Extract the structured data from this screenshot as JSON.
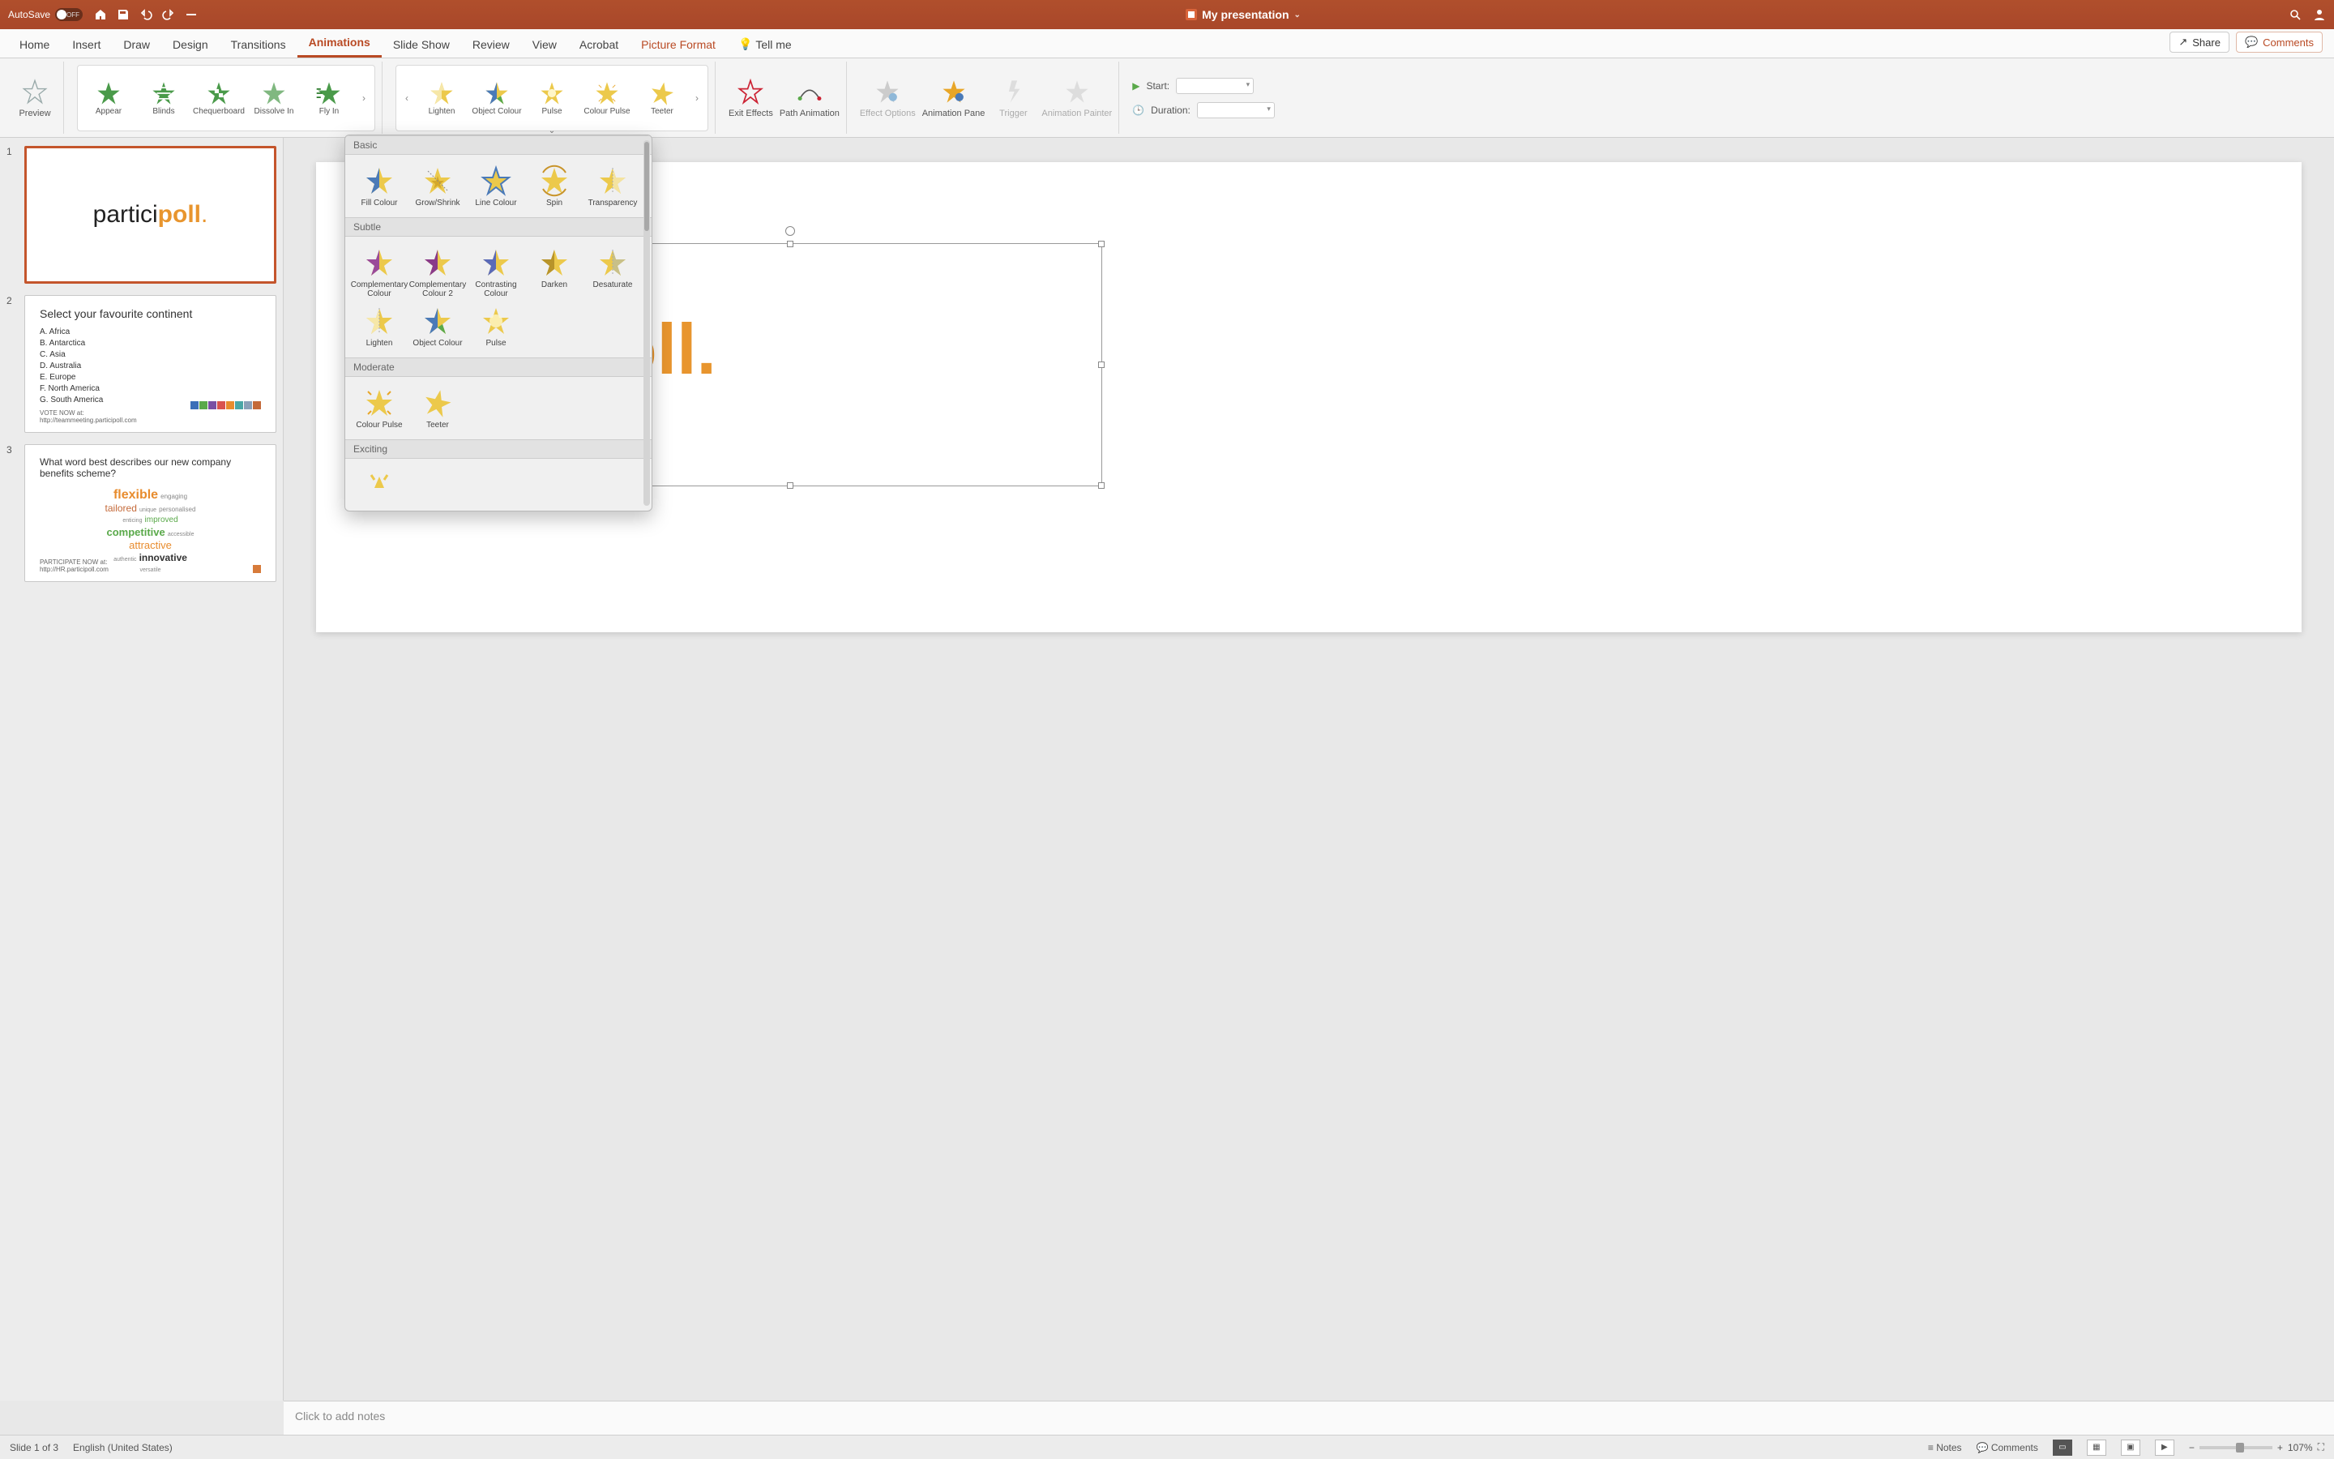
{
  "titlebar": {
    "autosave": "AutoSave",
    "toggle": "OFF",
    "title": "My presentation"
  },
  "tabs": {
    "items": [
      "Home",
      "Insert",
      "Draw",
      "Design",
      "Transitions",
      "Animations",
      "Slide Show",
      "Review",
      "View",
      "Acrobat",
      "Picture Format"
    ],
    "active_index": 5,
    "tellme": "Tell me",
    "share": "Share",
    "comments": "Comments"
  },
  "ribbon": {
    "preview": "Preview",
    "entrance": [
      {
        "label": "Appear"
      },
      {
        "label": "Blinds"
      },
      {
        "label": "Chequerboard"
      },
      {
        "label": "Dissolve In"
      },
      {
        "label": "Fly In"
      }
    ],
    "emphasis": [
      {
        "label": "Lighten"
      },
      {
        "label": "Object Colour"
      },
      {
        "label": "Pulse"
      },
      {
        "label": "Colour Pulse"
      },
      {
        "label": "Teeter"
      }
    ],
    "exit": "Exit Effects",
    "path": "Path Animation",
    "effect_options": "Effect Options",
    "animation_pane": "Animation Pane",
    "trigger": "Trigger",
    "animation_painter": "Animation Painter",
    "start": "Start:",
    "duration": "Duration:"
  },
  "dropdown": {
    "sections": [
      {
        "title": "Basic",
        "items": [
          "Fill Colour",
          "Grow/Shrink",
          "Line Colour",
          "Spin",
          "Transparency"
        ]
      },
      {
        "title": "Subtle",
        "items": [
          "Complementary Colour",
          "Complementary Colour 2",
          "Contrasting Colour",
          "Darken",
          "Desaturate",
          "Lighten",
          "Object Colour",
          "Pulse"
        ]
      },
      {
        "title": "Moderate",
        "items": [
          "Colour Pulse",
          "Teeter"
        ]
      },
      {
        "title": "Exciting",
        "items": [
          ""
        ]
      }
    ]
  },
  "thumbs": {
    "slide2": {
      "title": "Select your favourite continent",
      "items": [
        "A.  Africa",
        "B.  Antarctica",
        "C.  Asia",
        "D.  Australia",
        "E.  Europe",
        "F.  North America",
        "G.  South America"
      ],
      "foot1": "VOTE NOW at:",
      "foot2": "http://teammeeting.participoll.com"
    },
    "slide3": {
      "q": "What word best describes our new company benefits scheme?",
      "foot1": "PARTICIPATE NOW at:",
      "foot2": "http://HR.participoll.com",
      "words": {
        "flexible": "flexible",
        "engaging": "engaging",
        "tailored": "tailored",
        "unique": "unique",
        "personalised": "personalised",
        "enticing": "enticing",
        "improved": "improved",
        "competitive": "competitive",
        "accessible": "accessible",
        "attractive": "attractive",
        "authentic": "authentic",
        "innovative": "innovative",
        "versatile": "versatile"
      }
    }
  },
  "notes_placeholder": "Click to add notes",
  "status": {
    "slide": "Slide 1 of 3",
    "lang": "English (United States)",
    "notes": "Notes",
    "comments": "Comments",
    "zoom": "107%"
  },
  "colors": {
    "bar1": "#3b6fb8",
    "bar2": "#5aa94a",
    "bar3": "#7a4fa3",
    "bar4": "#d9534f",
    "bar5": "#e88c2e",
    "bar6": "#4aa6a6",
    "bar7": "#8aa0b8",
    "bar8": "#c46a3a"
  }
}
